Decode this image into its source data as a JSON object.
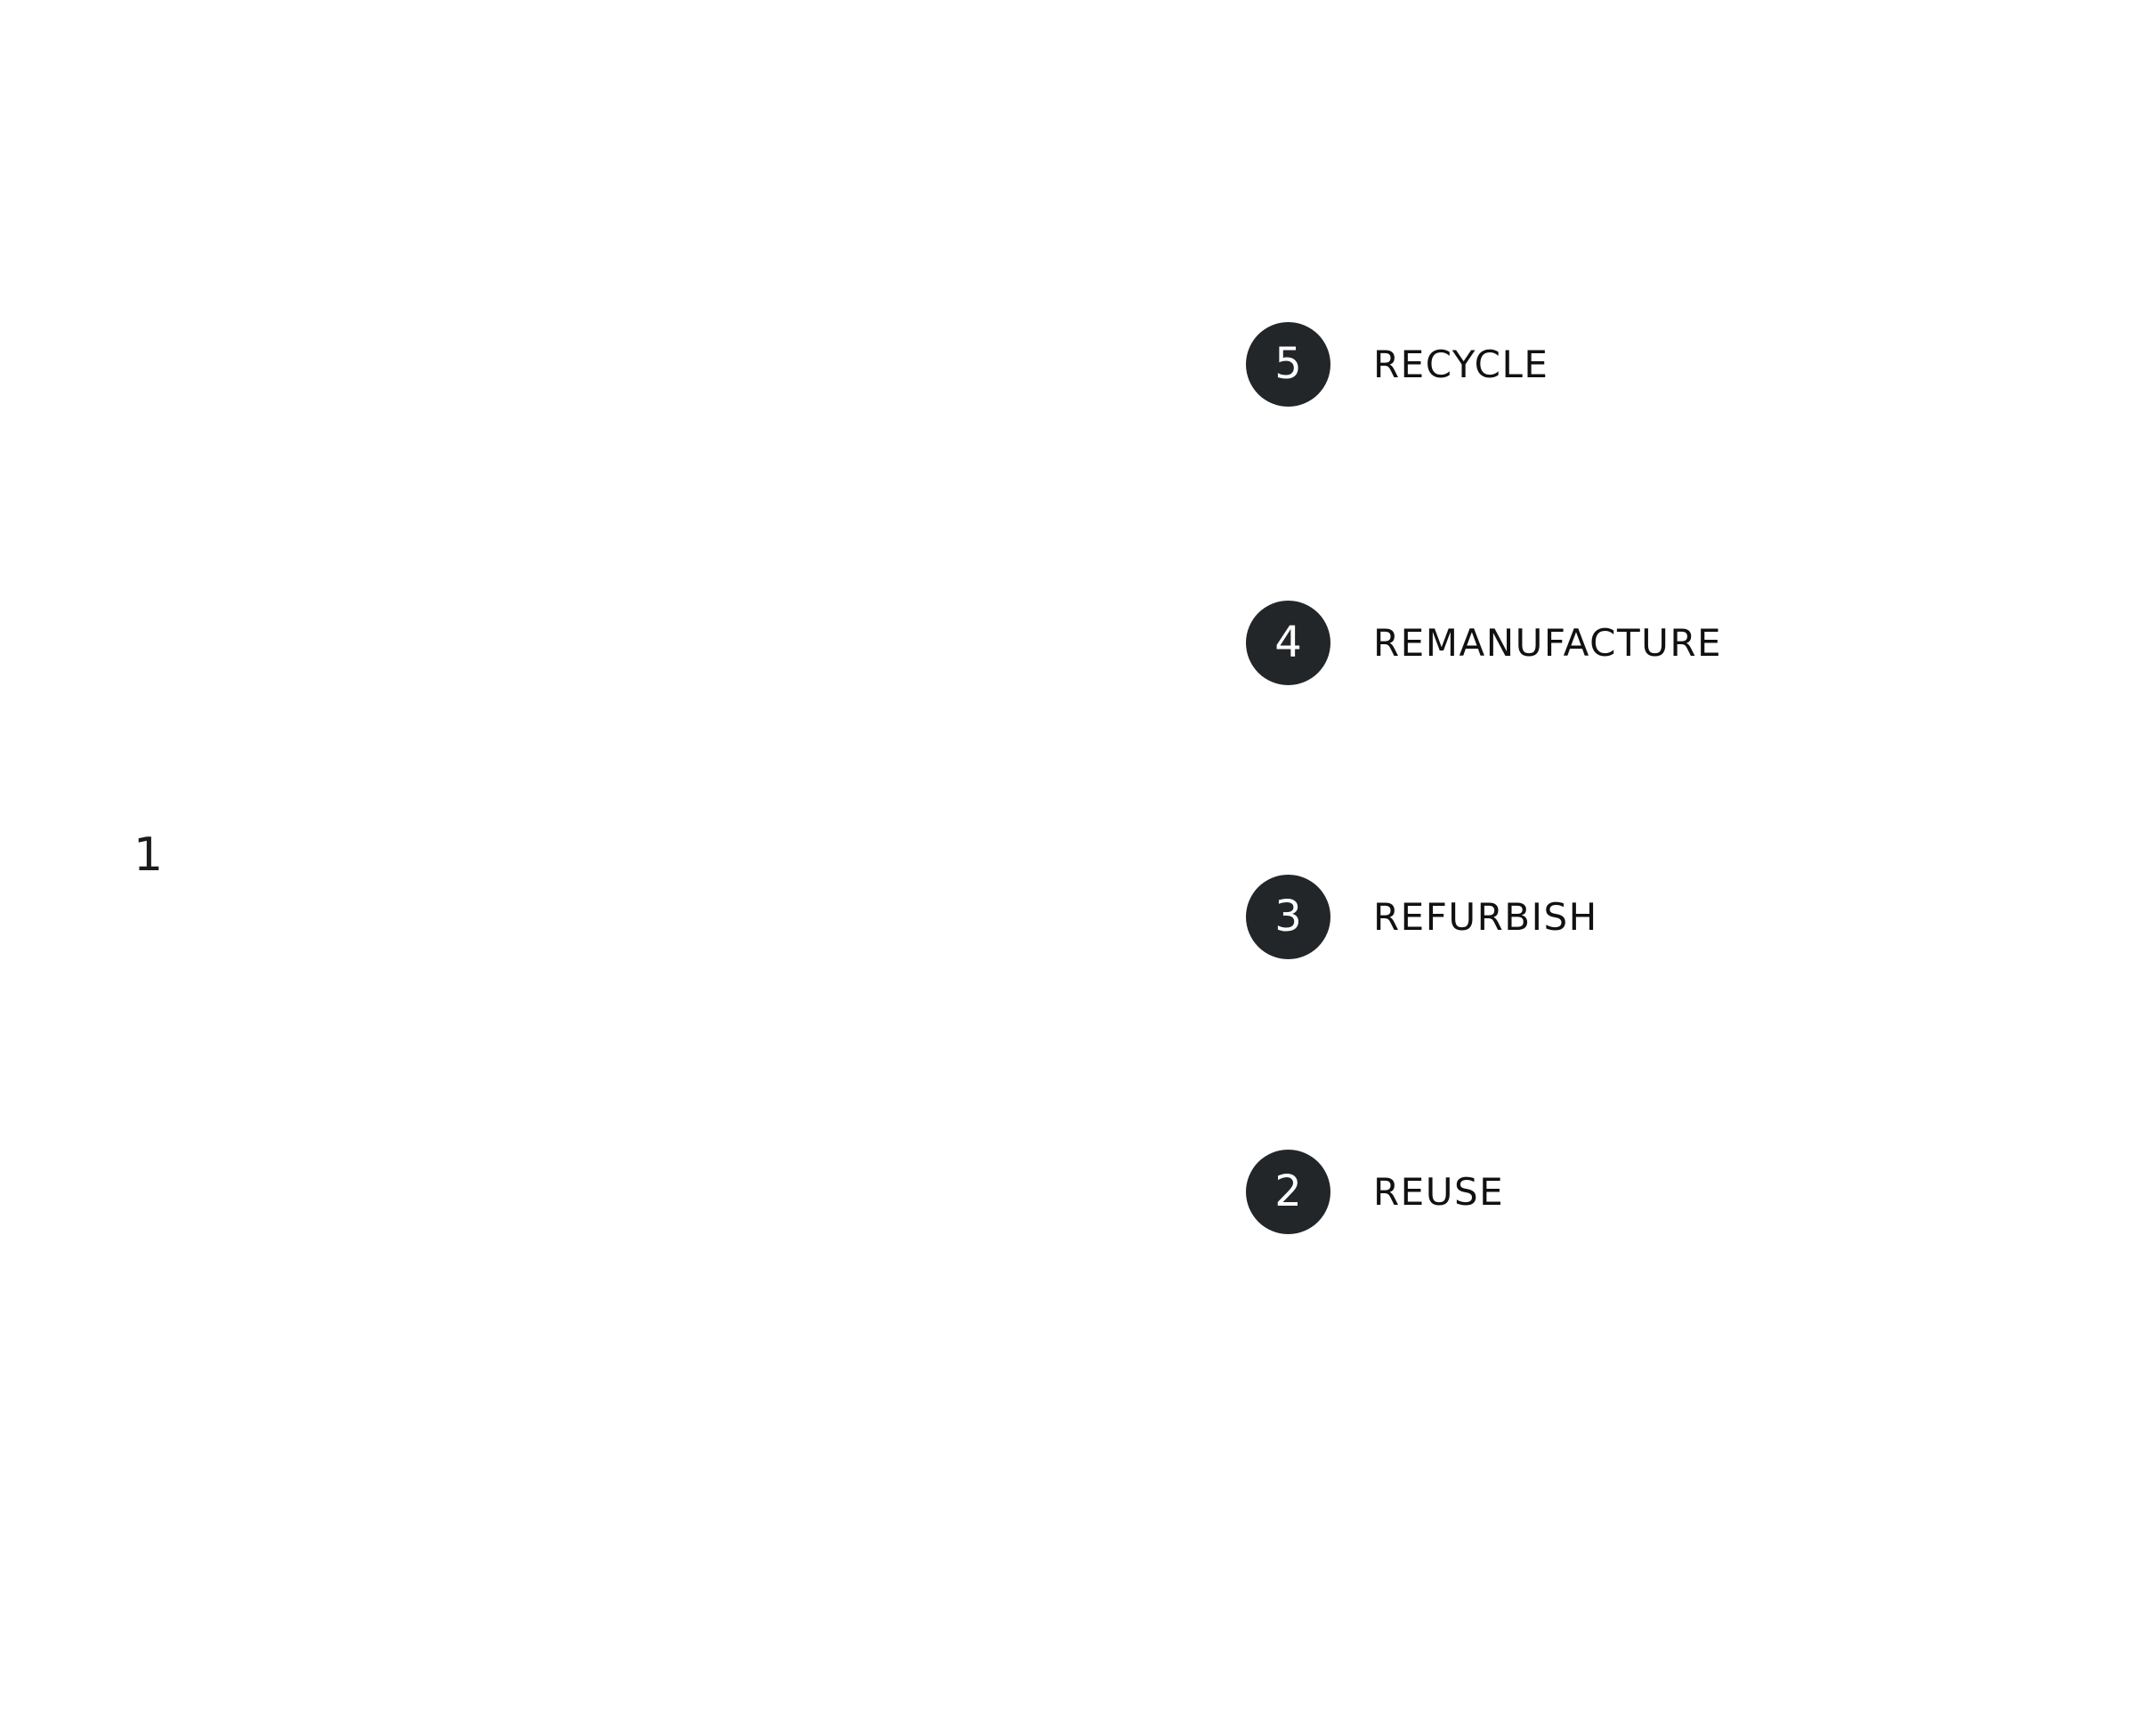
{
  "center_label": "1",
  "steps": [
    {
      "number": "5",
      "label": "RECYCLE"
    },
    {
      "number": "4",
      "label": "REMANUFACTURE"
    },
    {
      "number": "3",
      "label": "REFURBISH"
    },
    {
      "number": "2",
      "label": "REUSE"
    }
  ],
  "colors": {
    "badge_fill": "#222629",
    "badge_text": "#ffffff",
    "label_text": "#111111",
    "background": "#ffffff"
  }
}
